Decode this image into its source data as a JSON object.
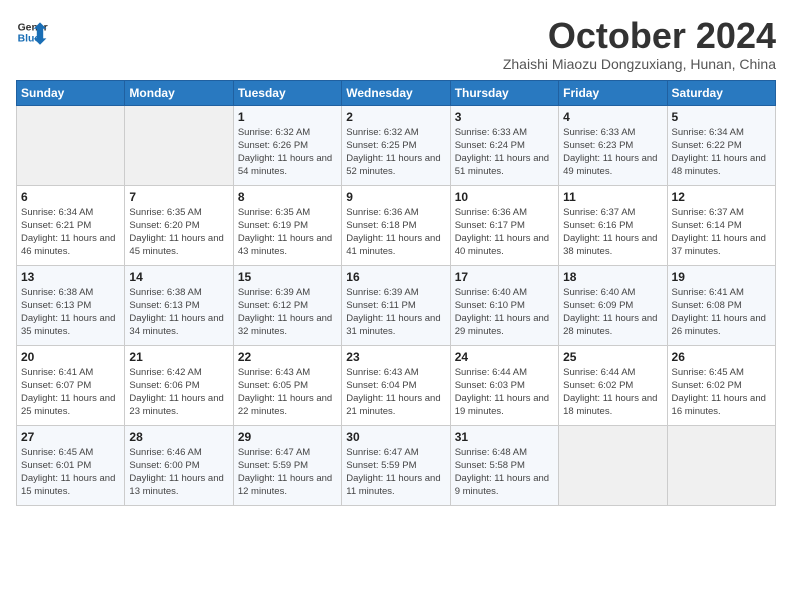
{
  "header": {
    "logo_line1": "General",
    "logo_line2": "Blue",
    "month_title": "October 2024",
    "subtitle": "Zhaishi Miaozu Dongzuxiang, Hunan, China"
  },
  "weekdays": [
    "Sunday",
    "Monday",
    "Tuesday",
    "Wednesday",
    "Thursday",
    "Friday",
    "Saturday"
  ],
  "weeks": [
    [
      {
        "day": "",
        "info": ""
      },
      {
        "day": "",
        "info": ""
      },
      {
        "day": "1",
        "info": "Sunrise: 6:32 AM\nSunset: 6:26 PM\nDaylight: 11 hours and 54 minutes."
      },
      {
        "day": "2",
        "info": "Sunrise: 6:32 AM\nSunset: 6:25 PM\nDaylight: 11 hours and 52 minutes."
      },
      {
        "day": "3",
        "info": "Sunrise: 6:33 AM\nSunset: 6:24 PM\nDaylight: 11 hours and 51 minutes."
      },
      {
        "day": "4",
        "info": "Sunrise: 6:33 AM\nSunset: 6:23 PM\nDaylight: 11 hours and 49 minutes."
      },
      {
        "day": "5",
        "info": "Sunrise: 6:34 AM\nSunset: 6:22 PM\nDaylight: 11 hours and 48 minutes."
      }
    ],
    [
      {
        "day": "6",
        "info": "Sunrise: 6:34 AM\nSunset: 6:21 PM\nDaylight: 11 hours and 46 minutes."
      },
      {
        "day": "7",
        "info": "Sunrise: 6:35 AM\nSunset: 6:20 PM\nDaylight: 11 hours and 45 minutes."
      },
      {
        "day": "8",
        "info": "Sunrise: 6:35 AM\nSunset: 6:19 PM\nDaylight: 11 hours and 43 minutes."
      },
      {
        "day": "9",
        "info": "Sunrise: 6:36 AM\nSunset: 6:18 PM\nDaylight: 11 hours and 41 minutes."
      },
      {
        "day": "10",
        "info": "Sunrise: 6:36 AM\nSunset: 6:17 PM\nDaylight: 11 hours and 40 minutes."
      },
      {
        "day": "11",
        "info": "Sunrise: 6:37 AM\nSunset: 6:16 PM\nDaylight: 11 hours and 38 minutes."
      },
      {
        "day": "12",
        "info": "Sunrise: 6:37 AM\nSunset: 6:14 PM\nDaylight: 11 hours and 37 minutes."
      }
    ],
    [
      {
        "day": "13",
        "info": "Sunrise: 6:38 AM\nSunset: 6:13 PM\nDaylight: 11 hours and 35 minutes."
      },
      {
        "day": "14",
        "info": "Sunrise: 6:38 AM\nSunset: 6:13 PM\nDaylight: 11 hours and 34 minutes."
      },
      {
        "day": "15",
        "info": "Sunrise: 6:39 AM\nSunset: 6:12 PM\nDaylight: 11 hours and 32 minutes."
      },
      {
        "day": "16",
        "info": "Sunrise: 6:39 AM\nSunset: 6:11 PM\nDaylight: 11 hours and 31 minutes."
      },
      {
        "day": "17",
        "info": "Sunrise: 6:40 AM\nSunset: 6:10 PM\nDaylight: 11 hours and 29 minutes."
      },
      {
        "day": "18",
        "info": "Sunrise: 6:40 AM\nSunset: 6:09 PM\nDaylight: 11 hours and 28 minutes."
      },
      {
        "day": "19",
        "info": "Sunrise: 6:41 AM\nSunset: 6:08 PM\nDaylight: 11 hours and 26 minutes."
      }
    ],
    [
      {
        "day": "20",
        "info": "Sunrise: 6:41 AM\nSunset: 6:07 PM\nDaylight: 11 hours and 25 minutes."
      },
      {
        "day": "21",
        "info": "Sunrise: 6:42 AM\nSunset: 6:06 PM\nDaylight: 11 hours and 23 minutes."
      },
      {
        "day": "22",
        "info": "Sunrise: 6:43 AM\nSunset: 6:05 PM\nDaylight: 11 hours and 22 minutes."
      },
      {
        "day": "23",
        "info": "Sunrise: 6:43 AM\nSunset: 6:04 PM\nDaylight: 11 hours and 21 minutes."
      },
      {
        "day": "24",
        "info": "Sunrise: 6:44 AM\nSunset: 6:03 PM\nDaylight: 11 hours and 19 minutes."
      },
      {
        "day": "25",
        "info": "Sunrise: 6:44 AM\nSunset: 6:02 PM\nDaylight: 11 hours and 18 minutes."
      },
      {
        "day": "26",
        "info": "Sunrise: 6:45 AM\nSunset: 6:02 PM\nDaylight: 11 hours and 16 minutes."
      }
    ],
    [
      {
        "day": "27",
        "info": "Sunrise: 6:45 AM\nSunset: 6:01 PM\nDaylight: 11 hours and 15 minutes."
      },
      {
        "day": "28",
        "info": "Sunrise: 6:46 AM\nSunset: 6:00 PM\nDaylight: 11 hours and 13 minutes."
      },
      {
        "day": "29",
        "info": "Sunrise: 6:47 AM\nSunset: 5:59 PM\nDaylight: 11 hours and 12 minutes."
      },
      {
        "day": "30",
        "info": "Sunrise: 6:47 AM\nSunset: 5:59 PM\nDaylight: 11 hours and 11 minutes."
      },
      {
        "day": "31",
        "info": "Sunrise: 6:48 AM\nSunset: 5:58 PM\nDaylight: 11 hours and 9 minutes."
      },
      {
        "day": "",
        "info": ""
      },
      {
        "day": "",
        "info": ""
      }
    ]
  ]
}
